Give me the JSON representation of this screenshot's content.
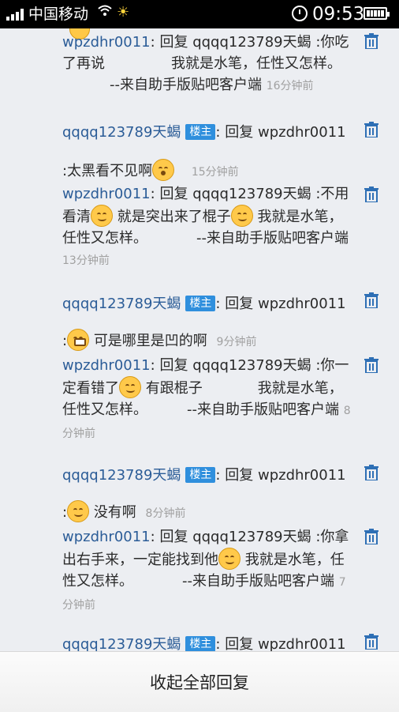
{
  "status_bar": {
    "carrier": "中国移动",
    "time": "09:53",
    "icons": [
      "signal-icon",
      "wifi-icon",
      "weather-sun-icon",
      "alarm-icon",
      "battery-icon"
    ]
  },
  "badge_label": "楼主",
  "reply_prefix": "回复",
  "replies": [
    {
      "user": "wpzdhr0011",
      "separator": ":",
      "target": "qqqq123789天蝎",
      "text_1": ":你吃了再说",
      "text_2": "我就是水笔，任性又怎样。",
      "text_3": "--来自助手版贴吧客户端",
      "time": "16分钟前"
    },
    {
      "user": "qqqq123789天蝎",
      "separator": ":",
      "target": "wpzdhr0011",
      "text_1": ":太黑看不见啊",
      "time": "15分钟前"
    },
    {
      "user": "wpzdhr0011",
      "separator": ":",
      "target": "qqqq123789天蝎",
      "text_1": ":不用看清",
      "text_2": "就是突出来了棍子",
      "text_3": "我就是水笔，任性又怎样。",
      "text_4": "--来自助手版贴吧客户端",
      "time": "13分钟前"
    },
    {
      "user": "qqqq123789天蝎",
      "separator": ":",
      "target": "wpzdhr0011",
      "text_1": ":",
      "text_2": "可是哪里是凹的啊",
      "time": "9分钟前"
    },
    {
      "user": "wpzdhr0011",
      "separator": ":",
      "target": "qqqq123789天蝎",
      "text_1": ":你一定看错了",
      "text_2": "有跟棍子",
      "text_3": "我就是水笔，任性又怎样。",
      "text_4": "--来自助手版贴吧客户端",
      "time": "8分钟前"
    },
    {
      "user": "qqqq123789天蝎",
      "separator": ":",
      "target": "wpzdhr0011",
      "text_1": ":",
      "text_2": "没有啊",
      "time": "8分钟前"
    },
    {
      "user": "wpzdhr0011",
      "separator": ":",
      "target": "qqqq123789天蝎",
      "text_1": ":你拿出右手来，一定能找到他",
      "text_2": "我就是水笔，任性又怎样。",
      "text_3": "--来自助手版贴吧客户端",
      "time": "7分钟前"
    }
  ],
  "partial_row": {
    "user": "qqqq123789天蝎",
    "target": "wpzdhr0011"
  },
  "bottom_bar": {
    "collapse_label": "收起全部回复"
  }
}
